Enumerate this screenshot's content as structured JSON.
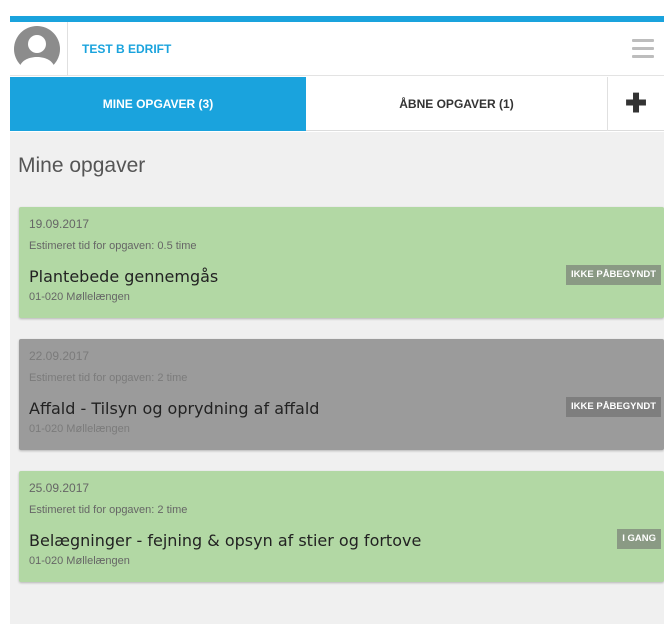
{
  "header": {
    "user_name": "TEST B EDRIFT",
    "avatar_icon": "user-silhouette-icon",
    "menu_icon": "hamburger-menu-icon"
  },
  "tabs": {
    "mine_label": "MINE OPGAVER (3)",
    "open_label": "ÅBNE OPGAVER (1)",
    "add_label": "✚"
  },
  "main": {
    "title": "Mine opgaver",
    "cards": [
      {
        "date": "19.09.2017",
        "estimate": "Estimeret tid for opgaven: 0.5 time",
        "task": "Plantebede gennemgås",
        "location": "01-020 Møllelængen",
        "status": "IKKE PÅBEGYNDT",
        "color": "#b2d8a4"
      },
      {
        "date": "22.09.2017",
        "estimate": "Estimeret tid for opgaven: 2 time",
        "task": "Affald - Tilsyn og oprydning af affald",
        "location": "01-020 Møllelængen",
        "status": "IKKE PÅBEGYNDT",
        "color": "#9b9b9b"
      },
      {
        "date": "25.09.2017",
        "estimate": "Estimeret tid for opgaven: 2 time",
        "task": "Belægninger - fejning & opsyn af stier og fortove",
        "location": "01-020 Møllelængen",
        "status": "I GANG",
        "color": "#b2d8a4"
      }
    ]
  },
  "colors": {
    "accent": "#1aa3dd",
    "background": "#f0f0f0"
  }
}
